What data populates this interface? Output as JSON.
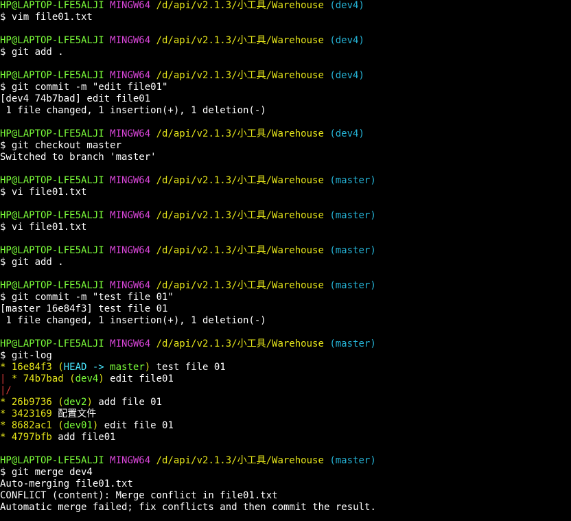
{
  "colors": {
    "default": "#ffffff",
    "green": "#7cff3a",
    "magenta": "#d946d9",
    "yellow": "#e5e51a",
    "cyan": "#25b3d6",
    "red": "#d63a3a",
    "bright_cyan": "#49e7ff"
  },
  "lines": [
    [
      {
        "t": "HP@LAPTOP-LFE5ALJI ",
        "c": "green"
      },
      {
        "t": "MINGW64 ",
        "c": "magenta"
      },
      {
        "t": "/d/api/v2.1.3/小工具/Warehouse ",
        "c": "yellow"
      },
      {
        "t": "(dev4)",
        "c": "cyan"
      }
    ],
    [
      {
        "t": "$ vim file01.txt",
        "c": "default"
      }
    ],
    [
      {
        "t": "",
        "c": "default"
      }
    ],
    [
      {
        "t": "HP@LAPTOP-LFE5ALJI ",
        "c": "green"
      },
      {
        "t": "MINGW64 ",
        "c": "magenta"
      },
      {
        "t": "/d/api/v2.1.3/小工具/Warehouse ",
        "c": "yellow"
      },
      {
        "t": "(dev4)",
        "c": "cyan"
      }
    ],
    [
      {
        "t": "$ git add .",
        "c": "default"
      }
    ],
    [
      {
        "t": "",
        "c": "default"
      }
    ],
    [
      {
        "t": "HP@LAPTOP-LFE5ALJI ",
        "c": "green"
      },
      {
        "t": "MINGW64 ",
        "c": "magenta"
      },
      {
        "t": "/d/api/v2.1.3/小工具/Warehouse ",
        "c": "yellow"
      },
      {
        "t": "(dev4)",
        "c": "cyan"
      }
    ],
    [
      {
        "t": "$ git commit -m \"edit file01\"",
        "c": "default"
      }
    ],
    [
      {
        "t": "[dev4 74b7bad] edit file01",
        "c": "default"
      }
    ],
    [
      {
        "t": " 1 file changed, 1 insertion(+), 1 deletion(-)",
        "c": "default"
      }
    ],
    [
      {
        "t": "",
        "c": "default"
      }
    ],
    [
      {
        "t": "HP@LAPTOP-LFE5ALJI ",
        "c": "green"
      },
      {
        "t": "MINGW64 ",
        "c": "magenta"
      },
      {
        "t": "/d/api/v2.1.3/小工具/Warehouse ",
        "c": "yellow"
      },
      {
        "t": "(dev4)",
        "c": "cyan"
      }
    ],
    [
      {
        "t": "$ git checkout master",
        "c": "default"
      }
    ],
    [
      {
        "t": "Switched to branch 'master'",
        "c": "default"
      }
    ],
    [
      {
        "t": "",
        "c": "default"
      }
    ],
    [
      {
        "t": "HP@LAPTOP-LFE5ALJI ",
        "c": "green"
      },
      {
        "t": "MINGW64 ",
        "c": "magenta"
      },
      {
        "t": "/d/api/v2.1.3/小工具/Warehouse ",
        "c": "yellow"
      },
      {
        "t": "(master)",
        "c": "cyan"
      }
    ],
    [
      {
        "t": "$ vi file01.txt",
        "c": "default"
      }
    ],
    [
      {
        "t": "",
        "c": "default"
      }
    ],
    [
      {
        "t": "HP@LAPTOP-LFE5ALJI ",
        "c": "green"
      },
      {
        "t": "MINGW64 ",
        "c": "magenta"
      },
      {
        "t": "/d/api/v2.1.3/小工具/Warehouse ",
        "c": "yellow"
      },
      {
        "t": "(master)",
        "c": "cyan"
      }
    ],
    [
      {
        "t": "$ vi file01.txt",
        "c": "default"
      }
    ],
    [
      {
        "t": "",
        "c": "default"
      }
    ],
    [
      {
        "t": "HP@LAPTOP-LFE5ALJI ",
        "c": "green"
      },
      {
        "t": "MINGW64 ",
        "c": "magenta"
      },
      {
        "t": "/d/api/v2.1.3/小工具/Warehouse ",
        "c": "yellow"
      },
      {
        "t": "(master)",
        "c": "cyan"
      }
    ],
    [
      {
        "t": "$ git add .",
        "c": "default"
      }
    ],
    [
      {
        "t": "",
        "c": "default"
      }
    ],
    [
      {
        "t": "HP@LAPTOP-LFE5ALJI ",
        "c": "green"
      },
      {
        "t": "MINGW64 ",
        "c": "magenta"
      },
      {
        "t": "/d/api/v2.1.3/小工具/Warehouse ",
        "c": "yellow"
      },
      {
        "t": "(master)",
        "c": "cyan"
      }
    ],
    [
      {
        "t": "$ git commit -m \"test file 01\"",
        "c": "default"
      }
    ],
    [
      {
        "t": "[master 16e84f3] test file 01",
        "c": "default"
      }
    ],
    [
      {
        "t": " 1 file changed, 1 insertion(+), 1 deletion(-)",
        "c": "default"
      }
    ],
    [
      {
        "t": "",
        "c": "default"
      }
    ],
    [
      {
        "t": "HP@LAPTOP-LFE5ALJI ",
        "c": "green"
      },
      {
        "t": "MINGW64 ",
        "c": "magenta"
      },
      {
        "t": "/d/api/v2.1.3/小工具/Warehouse ",
        "c": "yellow"
      },
      {
        "t": "(master)",
        "c": "cyan"
      }
    ],
    [
      {
        "t": "$ git-log",
        "c": "default"
      }
    ],
    [
      {
        "t": "* ",
        "c": "yellow"
      },
      {
        "t": "16e84f3 ",
        "c": "yellow"
      },
      {
        "t": "(",
        "c": "yellow"
      },
      {
        "t": "HEAD -> ",
        "c": "bright_cyan"
      },
      {
        "t": "master",
        "c": "green"
      },
      {
        "t": ")",
        "c": "yellow"
      },
      {
        "t": " test file 01",
        "c": "default"
      }
    ],
    [
      {
        "t": "| ",
        "c": "red"
      },
      {
        "t": "* ",
        "c": "yellow"
      },
      {
        "t": "74b7bad ",
        "c": "yellow"
      },
      {
        "t": "(",
        "c": "yellow"
      },
      {
        "t": "dev4",
        "c": "green"
      },
      {
        "t": ")",
        "c": "yellow"
      },
      {
        "t": " edit file01",
        "c": "default"
      }
    ],
    [
      {
        "t": "|/",
        "c": "red"
      }
    ],
    [
      {
        "t": "* ",
        "c": "yellow"
      },
      {
        "t": "26b9736 ",
        "c": "yellow"
      },
      {
        "t": "(",
        "c": "yellow"
      },
      {
        "t": "dev2",
        "c": "green"
      },
      {
        "t": ")",
        "c": "yellow"
      },
      {
        "t": " add file 01",
        "c": "default"
      }
    ],
    [
      {
        "t": "* ",
        "c": "yellow"
      },
      {
        "t": "3423169 ",
        "c": "yellow"
      },
      {
        "t": "配置文件",
        "c": "default"
      }
    ],
    [
      {
        "t": "* ",
        "c": "yellow"
      },
      {
        "t": "8682ac1 ",
        "c": "yellow"
      },
      {
        "t": "(",
        "c": "yellow"
      },
      {
        "t": "dev01",
        "c": "green"
      },
      {
        "t": ")",
        "c": "yellow"
      },
      {
        "t": " edit file 01",
        "c": "default"
      }
    ],
    [
      {
        "t": "* ",
        "c": "yellow"
      },
      {
        "t": "4797bfb ",
        "c": "yellow"
      },
      {
        "t": "add file01",
        "c": "default"
      }
    ],
    [
      {
        "t": "",
        "c": "default"
      }
    ],
    [
      {
        "t": "HP@LAPTOP-LFE5ALJI ",
        "c": "green"
      },
      {
        "t": "MINGW64 ",
        "c": "magenta"
      },
      {
        "t": "/d/api/v2.1.3/小工具/Warehouse ",
        "c": "yellow"
      },
      {
        "t": "(master)",
        "c": "cyan"
      }
    ],
    [
      {
        "t": "$ git merge dev4",
        "c": "default"
      }
    ],
    [
      {
        "t": "Auto-merging file01.txt",
        "c": "default"
      }
    ],
    [
      {
        "t": "CONFLICT (content): Merge conflict in file01.txt",
        "c": "default"
      }
    ],
    [
      {
        "t": "Automatic merge failed; fix conflicts and then commit the result.",
        "c": "default"
      }
    ]
  ]
}
